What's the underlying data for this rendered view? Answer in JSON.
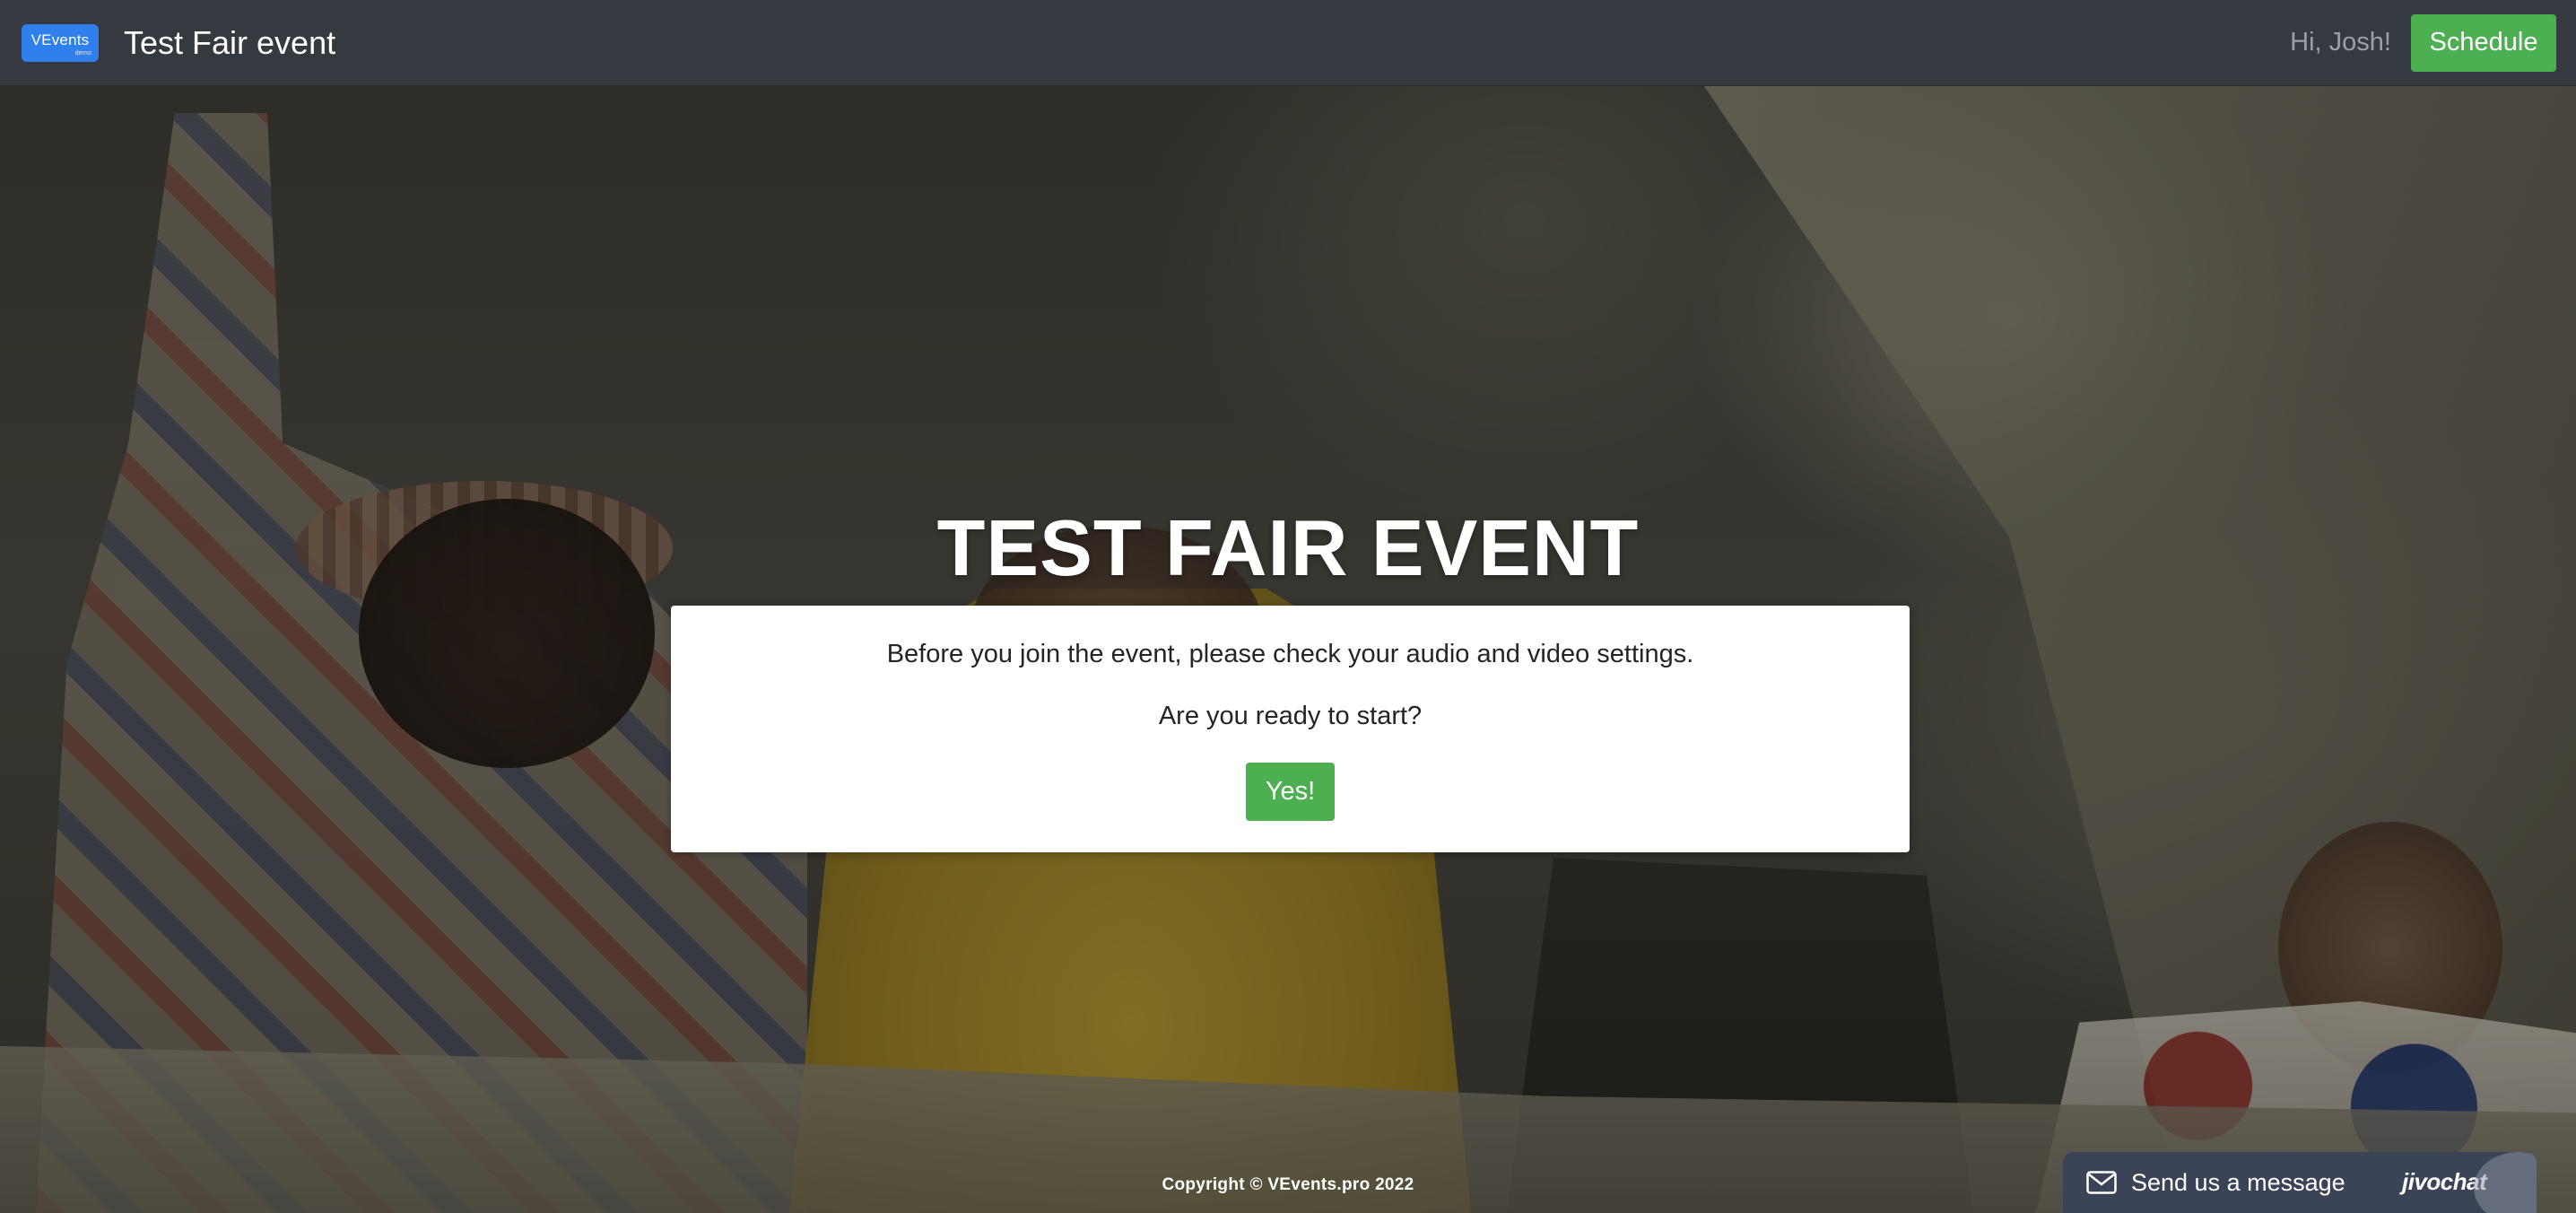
{
  "header": {
    "logo_text": "VEvents",
    "logo_subtext": "demo",
    "title": "Test Fair event",
    "greeting": "Hi, Josh!",
    "schedule_label": "Schedule"
  },
  "main": {
    "event_title": "TEST FAIR EVENT",
    "prejoin": {
      "message": "Before you join the event, please check your audio and video settings.",
      "question": "Are you ready to start?",
      "confirm_label": "Yes!"
    }
  },
  "footer": {
    "copyright": "Copyright © VEvents.pro 2022"
  },
  "chat_widget": {
    "label": "Send us a message",
    "brand": "jivochat",
    "icon": "mail-icon"
  },
  "colors": {
    "navbar": "#343a40",
    "brand_blue": "#2f80ed",
    "success_green": "#4caf50",
    "chat_bg": "#3b4356"
  }
}
